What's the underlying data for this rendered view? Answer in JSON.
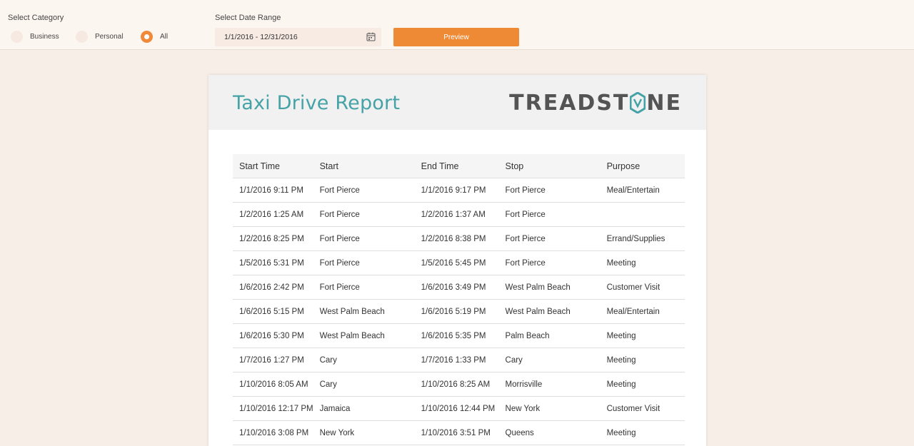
{
  "filters": {
    "category_label": "Select Category",
    "options": [
      {
        "label": "Business",
        "selected": false
      },
      {
        "label": "Personal",
        "selected": false
      },
      {
        "label": "All",
        "selected": true
      }
    ],
    "date_label": "Select Date Range",
    "date_value": "1/1/2016 - 12/31/2016",
    "preview_label": "Preview"
  },
  "report": {
    "title": "Taxi Drive Report",
    "logo_text_left": "TREADST",
    "logo_text_right": "NE",
    "columns": [
      "Start Time",
      "Start",
      "End Time",
      "Stop",
      "Purpose"
    ],
    "rows": [
      [
        "1/1/2016 9:11 PM",
        "Fort Pierce",
        "1/1/2016 9:17 PM",
        "Fort Pierce",
        "Meal/Entertain"
      ],
      [
        "1/2/2016 1:25 AM",
        "Fort Pierce",
        "1/2/2016 1:37 AM",
        "Fort Pierce",
        ""
      ],
      [
        "1/2/2016 8:25 PM",
        "Fort Pierce",
        "1/2/2016 8:38 PM",
        "Fort Pierce",
        "Errand/Supplies"
      ],
      [
        "1/5/2016 5:31 PM",
        "Fort Pierce",
        "1/5/2016 5:45 PM",
        "Fort Pierce",
        "Meeting"
      ],
      [
        "1/6/2016 2:42 PM",
        "Fort Pierce",
        "1/6/2016 3:49 PM",
        "West Palm Beach",
        "Customer Visit"
      ],
      [
        "1/6/2016 5:15 PM",
        "West Palm Beach",
        "1/6/2016 5:19 PM",
        "West Palm Beach",
        "Meal/Entertain"
      ],
      [
        "1/6/2016 5:30 PM",
        "West Palm Beach",
        "1/6/2016 5:35 PM",
        "Palm Beach",
        "Meeting"
      ],
      [
        "1/7/2016 1:27 PM",
        "Cary",
        "1/7/2016 1:33 PM",
        "Cary",
        "Meeting"
      ],
      [
        "1/10/2016 8:05 AM",
        "Cary",
        "1/10/2016 8:25 AM",
        "Morrisville",
        "Meeting"
      ],
      [
        "1/10/2016 12:17 PM",
        "Jamaica",
        "1/10/2016 12:44 PM",
        "New York",
        "Customer Visit"
      ],
      [
        "1/10/2016 3:08 PM",
        "New York",
        "1/10/2016 3:51 PM",
        "Queens",
        "Meeting"
      ]
    ]
  },
  "colors": {
    "accent": "#ee8a35",
    "title": "#45a2a6",
    "logo": "#545454"
  }
}
